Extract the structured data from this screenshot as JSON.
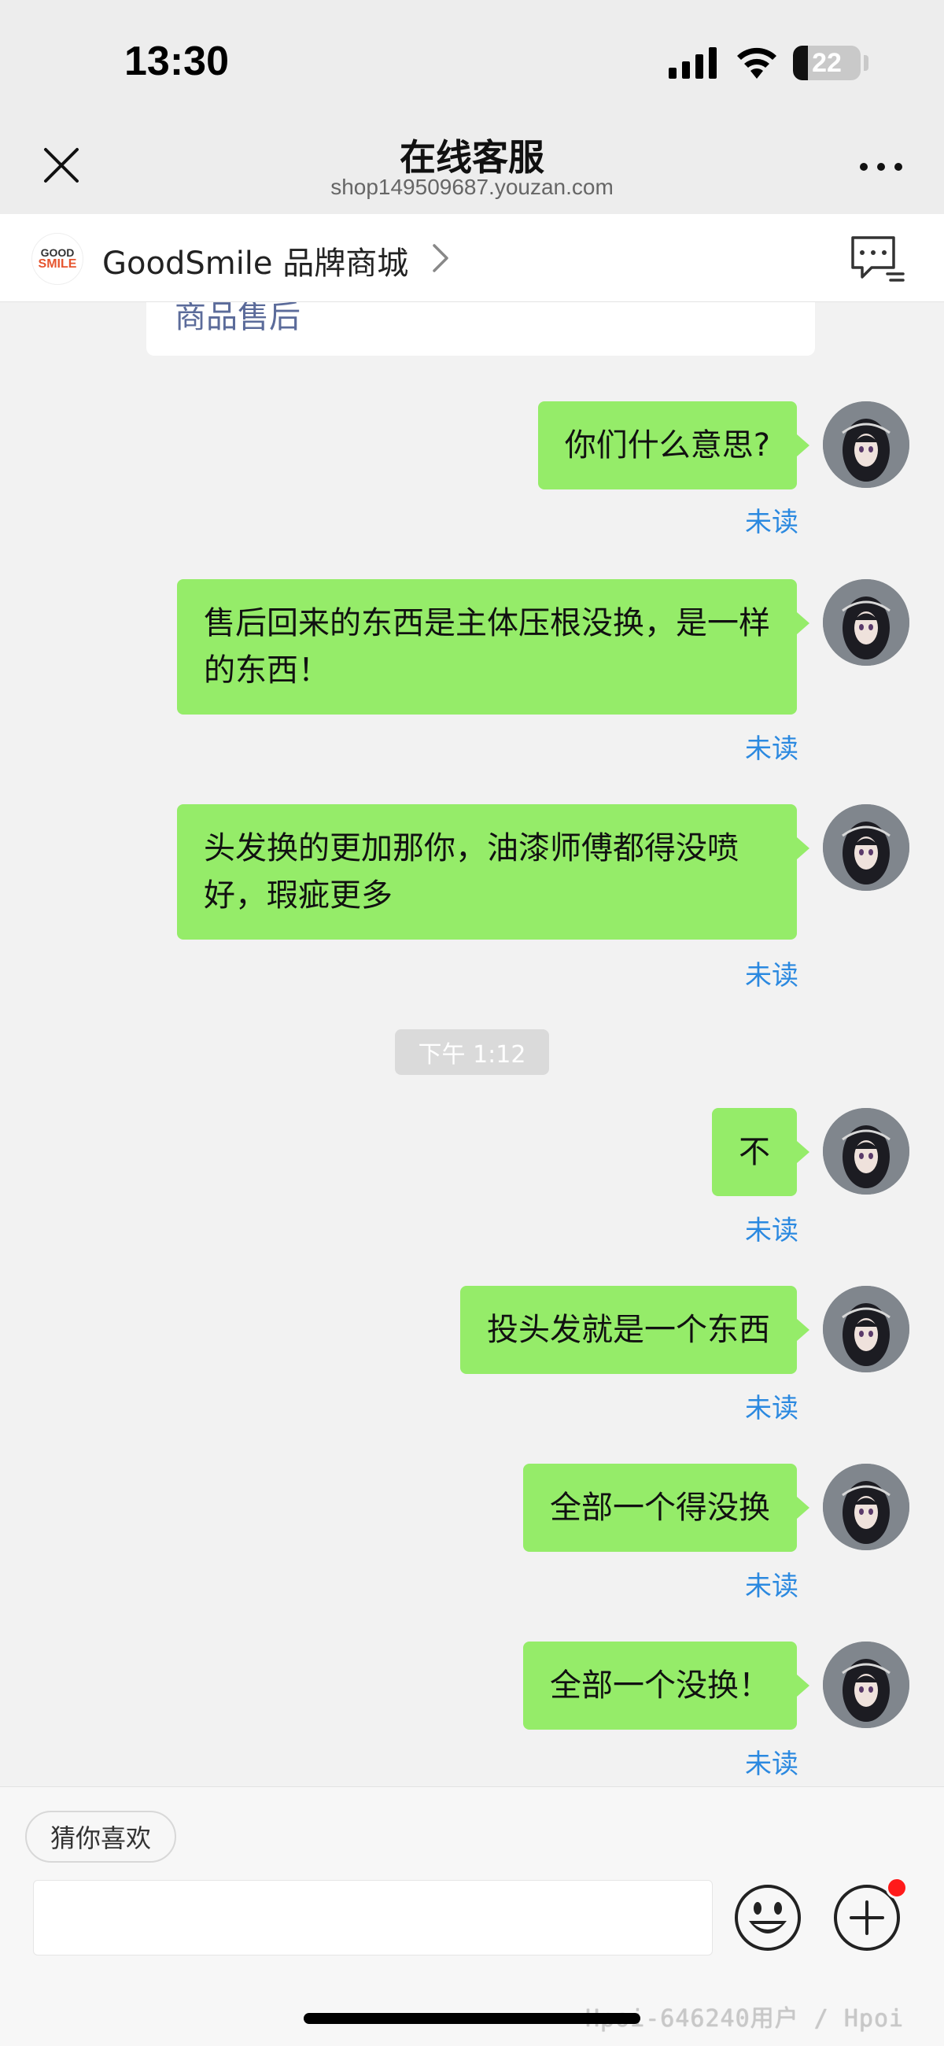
{
  "status_bar": {
    "time": "13:30",
    "battery_level": "22",
    "icons": [
      "signal-icon",
      "wifi-icon",
      "battery-icon"
    ]
  },
  "nav": {
    "title": "在线客服",
    "subtitle": "shop149509687.youzan.com",
    "close_icon": "close-icon",
    "more_icon": "more-icon"
  },
  "shop": {
    "logo_top": "GOOD",
    "logo_bottom": "SMILE",
    "name": "GoodSmile 品牌商城",
    "chat_list_icon": "chat-list-icon"
  },
  "previous_card": {
    "text": "商品售后"
  },
  "messages": [
    {
      "text": "你们什么意思?",
      "status": "未读"
    },
    {
      "text": "售后回来的东西是主体压根没换，是一样的东西！",
      "status": "未读"
    },
    {
      "text": "头发换的更加那你，油漆师傅都得没喷好，瑕疵更多",
      "status": "未读"
    },
    {
      "text": "不",
      "status": "未读"
    },
    {
      "text": "投头发就是一个东西",
      "status": "未读"
    },
    {
      "text": "全部一个得没换",
      "status": "未读"
    },
    {
      "text": "全部一个没换！",
      "status": "未读"
    }
  ],
  "time_divider": "下午 1:12",
  "bottom": {
    "guess_chip": "猜你喜欢",
    "input_value": "",
    "input_placeholder": "",
    "emoji_icon": "emoji-icon",
    "plus_icon": "plus-icon"
  },
  "watermark": "Hpoi-646240用户 / Hpoi",
  "colors": {
    "bubble": "#95ec69",
    "unread": "#2b89e0",
    "background": "#f2f2f2",
    "badge": "#ff1a1a"
  }
}
